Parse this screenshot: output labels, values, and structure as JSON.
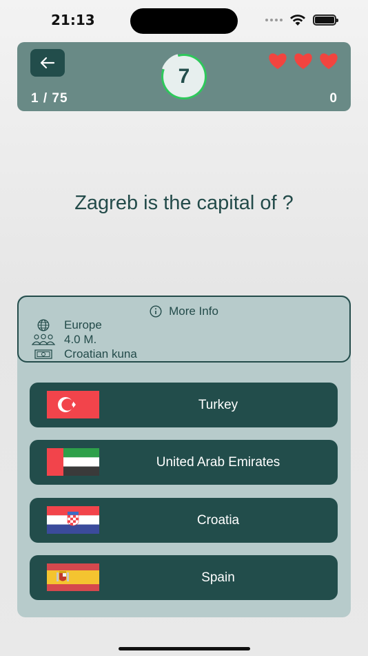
{
  "status": {
    "time": "21:13"
  },
  "header": {
    "progress": "1 / 75",
    "score": "0",
    "timer": "7",
    "timer_fraction": 0.85,
    "lives": 3,
    "colors": {
      "header_bg": "#698a86",
      "accent": "#2ec85b",
      "heart": "#f2443f",
      "dark": "#224d4b"
    }
  },
  "question": "Zagreb is the capital of ?",
  "info": {
    "title": "More Info",
    "continent": "Europe",
    "population": "4.0 M.",
    "currency": "Croatian kuna",
    "icons": [
      "info-icon",
      "globe-icon",
      "people-icon",
      "banknote-icon"
    ]
  },
  "answers": [
    {
      "label": "Turkey",
      "flag": "turkey"
    },
    {
      "label": "United Arab Emirates",
      "flag": "uae"
    },
    {
      "label": "Croatia",
      "flag": "croatia"
    },
    {
      "label": "Spain",
      "flag": "spain"
    }
  ]
}
